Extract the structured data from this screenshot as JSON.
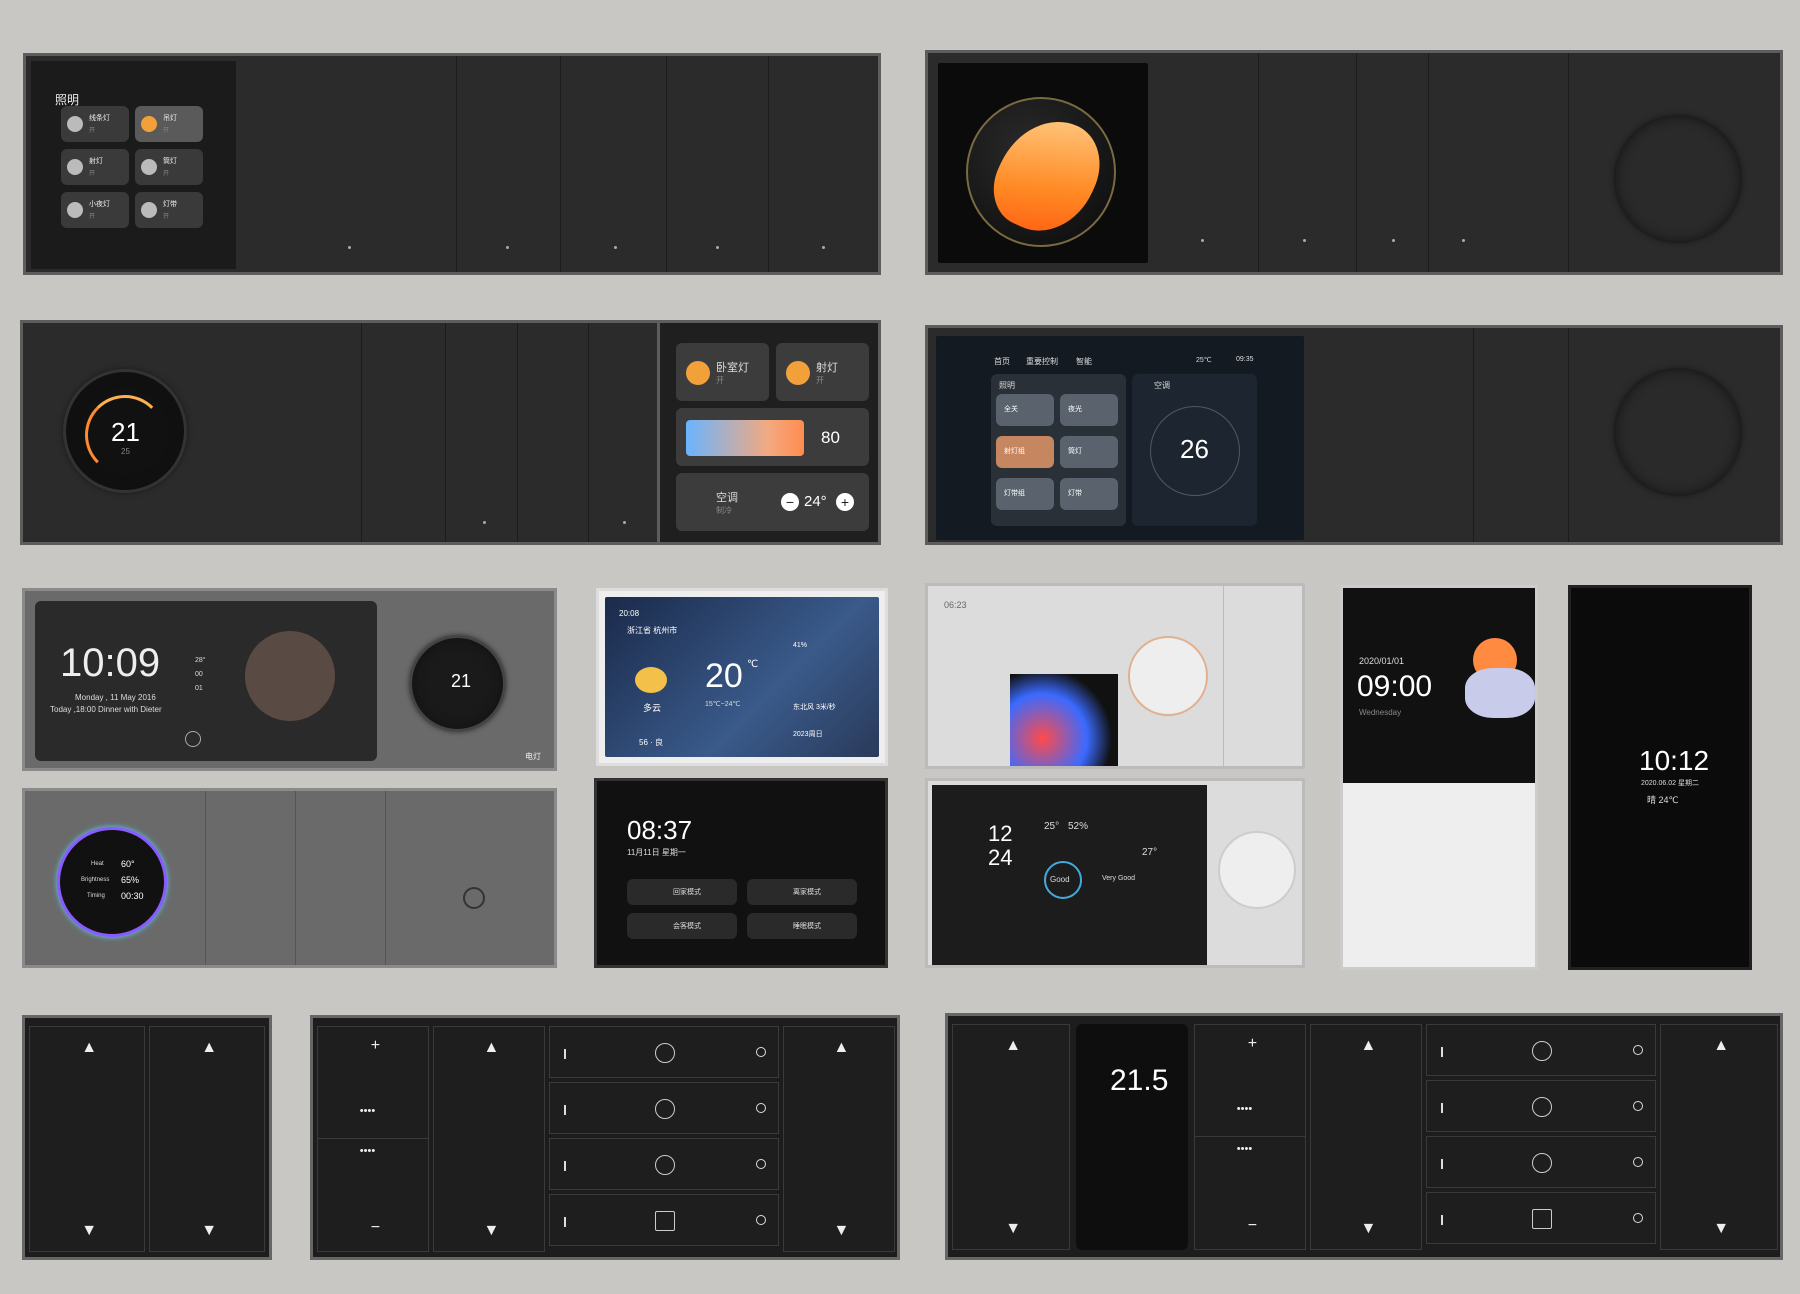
{
  "p1": {
    "title": "照明",
    "items": [
      {
        "label": "线条灯",
        "sub": "开"
      },
      {
        "label": "吊灯",
        "sub": "开"
      },
      {
        "label": "射灯",
        "sub": "开"
      },
      {
        "label": "筒灯",
        "sub": "开"
      },
      {
        "label": "小夜灯",
        "sub": "开"
      },
      {
        "label": "灯带",
        "sub": "开"
      }
    ]
  },
  "p3": {
    "temp": "21",
    "unit": "℃",
    "sub": "25"
  },
  "p4": {
    "light1": "卧室灯",
    "light1_sub": "开",
    "light2": "射灯",
    "light2_sub": "开",
    "brightness": "80",
    "ac": "空调",
    "ac_sub": "制冷",
    "ac_temp": "24°",
    "minus": "−",
    "plus": "+"
  },
  "p5": {
    "tabs": [
      "首页",
      "重要控制",
      "智能"
    ],
    "weather": "25℃",
    "time": "09:35",
    "scene_title": "照明",
    "ac_title": "空调",
    "ac_temp": "26",
    "tiles": [
      "全关",
      "夜光",
      "射灯组",
      "筒灯",
      "灯带组",
      "灯带"
    ]
  },
  "p6": {
    "time": "10:09",
    "date": "Monday , 11 May 2016",
    "event": "Today ,18:00  Dinner with Dieter",
    "side": [
      "28°",
      "00",
      "01"
    ],
    "thermo_temp": "21",
    "label": "电灯"
  },
  "p7": {
    "time": "20:08",
    "location": "浙江省 杭州市",
    "temp": "20",
    "unit": "℃",
    "range": "15℃~24℃",
    "weather": "多云",
    "aqi": "56 · 良",
    "humidity": "41%",
    "wind": "东北风 3米/秒",
    "date": "2023周日"
  },
  "p8": {
    "time": "08:37",
    "date": "11月11日 星期一",
    "scenes": [
      "回家模式",
      "离家模式",
      "会客模式",
      "睡眠模式"
    ]
  },
  "p9": {
    "time": "06:23"
  },
  "p10": {
    "date": "2020/01/01",
    "time": "09:00",
    "weekday": "Wednesday"
  },
  "p11": {
    "time": "10:12",
    "date": "2020.06.02 星期二",
    "weather": "晴 24℃"
  },
  "p12": {
    "temp": "60°",
    "bright": "65%",
    "timing": "00:30",
    "l1": "Heat",
    "l2": "Brightness",
    "l3": "Timing"
  },
  "p13": {
    "month": "12",
    "day": "24",
    "t1": "25°",
    "t2": "52%",
    "status": "Good",
    "quality": "Very Good",
    "t3": "27°"
  },
  "p14": {
    "temp": "21.5"
  },
  "keys": {
    "plus": "+",
    "minus": "−",
    "dots": "••••",
    "up": "▲",
    "down": "▼"
  }
}
